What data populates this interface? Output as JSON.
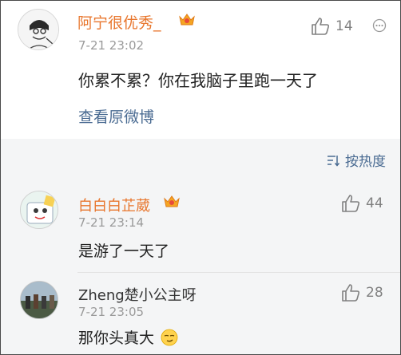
{
  "post": {
    "username": "阿宁很优秀_",
    "time": "7-21 23:02",
    "content": "你累不累？你在我脑子里跑一天了",
    "likes": "14",
    "view_original": "查看原微博"
  },
  "sort": {
    "label": "按热度"
  },
  "replies": [
    {
      "username": "白白白芷葳",
      "time": "7-21 23:14",
      "content": "是游了一天了",
      "likes": "44"
    },
    {
      "username": "Zheng楚小公主呀",
      "time": "7-21 23:05",
      "content": "那你头真大",
      "likes": "28"
    }
  ],
  "colors": {
    "username": "#e8762d",
    "link": "#4a6b92",
    "gray": "#9a9a9a",
    "panel": "#f4f5f6"
  }
}
